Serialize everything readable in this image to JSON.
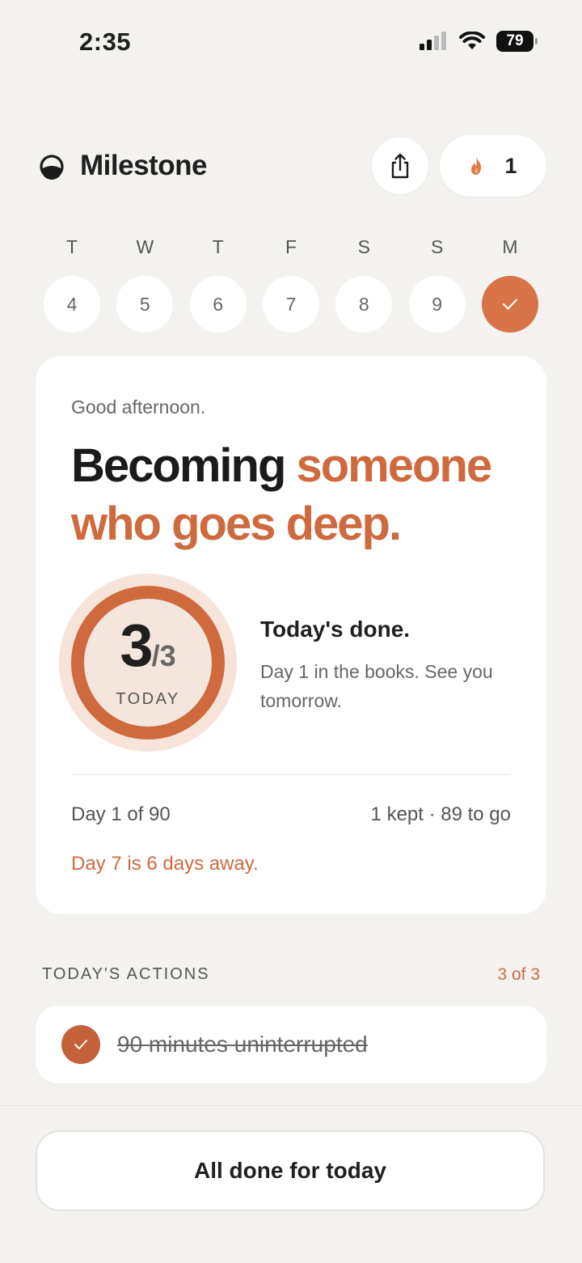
{
  "status_bar": {
    "time": "2:35",
    "battery": "79"
  },
  "header": {
    "title": "Milestone",
    "streak_count": "1"
  },
  "week": [
    {
      "letter": "T",
      "date": "4",
      "done": false
    },
    {
      "letter": "W",
      "date": "5",
      "done": false
    },
    {
      "letter": "T",
      "date": "6",
      "done": false
    },
    {
      "letter": "F",
      "date": "7",
      "done": false
    },
    {
      "letter": "S",
      "date": "8",
      "done": false
    },
    {
      "letter": "S",
      "date": "9",
      "done": false
    },
    {
      "letter": "M",
      "date": "",
      "done": true
    }
  ],
  "card": {
    "greeting": "Good afternoon.",
    "headline_plain": "Becoming",
    "headline_accent": "someone who goes deep.",
    "ring": {
      "completed": "3",
      "total": "/3",
      "label": "TODAY",
      "progress": 1.0
    },
    "done_title": "Today's done.",
    "done_subtitle": "Day 1 in the books. See you tomorrow.",
    "day_progress": "Day 1 of 90",
    "kept_summary": "1 kept · 89 to go",
    "next_milestone": "Day 7 is 6 days away."
  },
  "actions": {
    "section_label": "TODAY'S ACTIONS",
    "count_label": "3 of 3",
    "items": [
      {
        "label": "90 minutes uninterrupted",
        "done": true
      }
    ]
  },
  "cta": {
    "label": "All done for today"
  },
  "colors": {
    "accent": "#cf6a3e",
    "background": "#f3f2ef",
    "card": "#ffffff"
  }
}
